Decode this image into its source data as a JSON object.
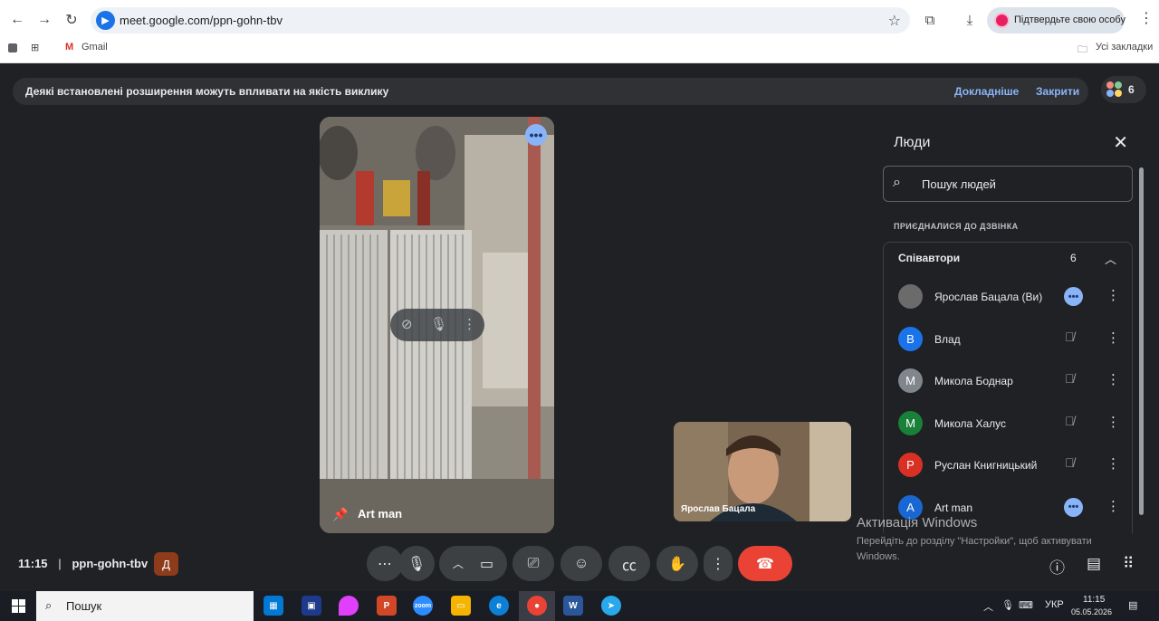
{
  "browser": {
    "url": "meet.google.com/ppn-gohn-tbv",
    "profile_label": "Підтвердьте свою особу",
    "bookmarks": {
      "gmail": "Gmail",
      "all_bookmarks": "Усі закладки"
    }
  },
  "banner": {
    "text": "Деякі встановлені розширення можуть впливати на якість виклику",
    "learn_more": "Докладніше",
    "close": "Закрити"
  },
  "participant_count": "6",
  "main_tile": {
    "name": "Art man"
  },
  "self_tile": {
    "name": "Ярослав Бацала"
  },
  "people_panel": {
    "title": "Люди",
    "search_placeholder": "Пошук людей",
    "section_label": "ПРИЄДНАЛИСЯ ДО ДЗВІНКА",
    "group_label": "Співавтори",
    "group_count": "6",
    "participants": [
      {
        "name": "Ярослав Бацала (Ви)",
        "initial": "",
        "color": "#6b6b6b",
        "state": "speaking"
      },
      {
        "name": "Влад",
        "initial": "В",
        "color": "#1a73e8",
        "state": "muted"
      },
      {
        "name": "Микола Боднар",
        "initial": "М",
        "color": "#80868b",
        "state": "muted"
      },
      {
        "name": "Микола Халус",
        "initial": "М",
        "color": "#188038",
        "state": "muted"
      },
      {
        "name": "Руслан Книгницький",
        "initial": "Р",
        "color": "#d93025",
        "state": "muted"
      },
      {
        "name": "Art man",
        "initial": "A",
        "color": "#1967d2",
        "state": "speaking"
      }
    ]
  },
  "meeting": {
    "time": "11:15",
    "code": "ppn-gohn-tbv",
    "badge": "Д"
  },
  "watermark": {
    "title": "Активація Windows",
    "subtitle": "Перейдіть до розділу \"Настройки\", щоб активувати Windows."
  },
  "taskbar": {
    "search": "Пошук",
    "lang": "УКР",
    "time": "11:15",
    "date": "05.05.2026"
  }
}
